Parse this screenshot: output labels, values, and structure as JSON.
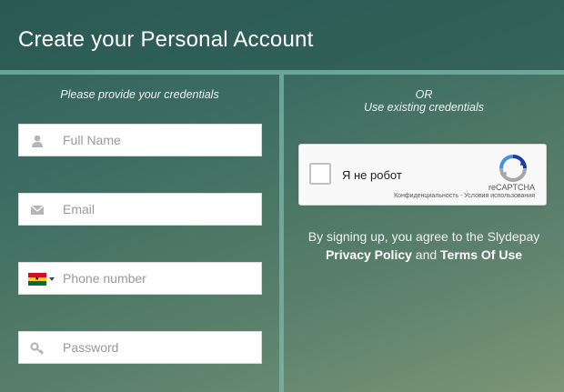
{
  "header": {
    "title": "Create your Personal Account"
  },
  "left": {
    "heading": "Please provide your credentials",
    "fields": [
      {
        "placeholder": "Full Name",
        "icon": "user-icon"
      },
      {
        "placeholder": "Email",
        "icon": "envelope-icon"
      },
      {
        "placeholder": "Phone number",
        "icon": "ghana-flag-icon"
      },
      {
        "placeholder": "Password",
        "icon": "key-icon"
      }
    ]
  },
  "right": {
    "or_label": "OR",
    "alt_heading": "Use existing credentials",
    "captcha": {
      "label": "Я не робот",
      "brand": "reCAPTCHA",
      "links": "Конфиденциальность - Условия использования"
    },
    "terms": {
      "prefix": "By signing up, you agree to the Slydepay",
      "privacy": "Privacy Policy",
      "and": "and",
      "tos": "Terms Of Use"
    }
  },
  "colors": {
    "background": "#3e6e62",
    "divider": "#78b9aa",
    "input_bg": "#ffffff",
    "placeholder": "#9a9a9a"
  }
}
